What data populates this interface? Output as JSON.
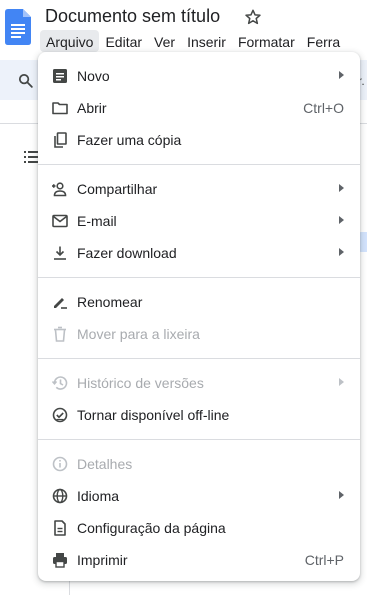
{
  "document": {
    "title": "Documento sem título"
  },
  "menubar": {
    "items": [
      {
        "label": "Arquivo",
        "active": true
      },
      {
        "label": "Editar"
      },
      {
        "label": "Ver"
      },
      {
        "label": "Inserir"
      },
      {
        "label": "Formatar"
      },
      {
        "label": "Ferra"
      }
    ]
  },
  "toolbar": {
    "overflow_glyph": "r."
  },
  "file_menu": {
    "items": [
      {
        "label": "Novo",
        "icon": "new-document-icon",
        "submenu": true
      },
      {
        "label": "Abrir",
        "icon": "folder-icon",
        "shortcut": "Ctrl+O"
      },
      {
        "label": "Fazer uma cópia",
        "icon": "copy-icon"
      },
      {
        "label": "Compartilhar",
        "icon": "share-person-icon",
        "submenu": true
      },
      {
        "label": "E-mail",
        "icon": "email-icon",
        "submenu": true
      },
      {
        "label": "Fazer download",
        "icon": "download-icon",
        "submenu": true
      },
      {
        "label": "Renomear",
        "icon": "rename-pen-icon"
      },
      {
        "label": "Mover para a lixeira",
        "icon": "trash-icon",
        "disabled": true
      },
      {
        "label": "Histórico de versões",
        "icon": "history-icon",
        "submenu": true,
        "disabled": true
      },
      {
        "label": "Tornar disponível off-line",
        "icon": "offline-check-icon"
      },
      {
        "label": "Detalhes",
        "icon": "info-icon",
        "disabled": true
      },
      {
        "label": "Idioma",
        "icon": "globe-icon",
        "submenu": true
      },
      {
        "label": "Configuração da página",
        "icon": "page-setup-icon"
      },
      {
        "label": "Imprimir",
        "icon": "printer-icon",
        "shortcut": "Ctrl+P"
      }
    ]
  },
  "colors": {
    "accent": "#4285f4",
    "text": "#202124",
    "disabled": "#a8abaf",
    "icon": "#444746"
  }
}
